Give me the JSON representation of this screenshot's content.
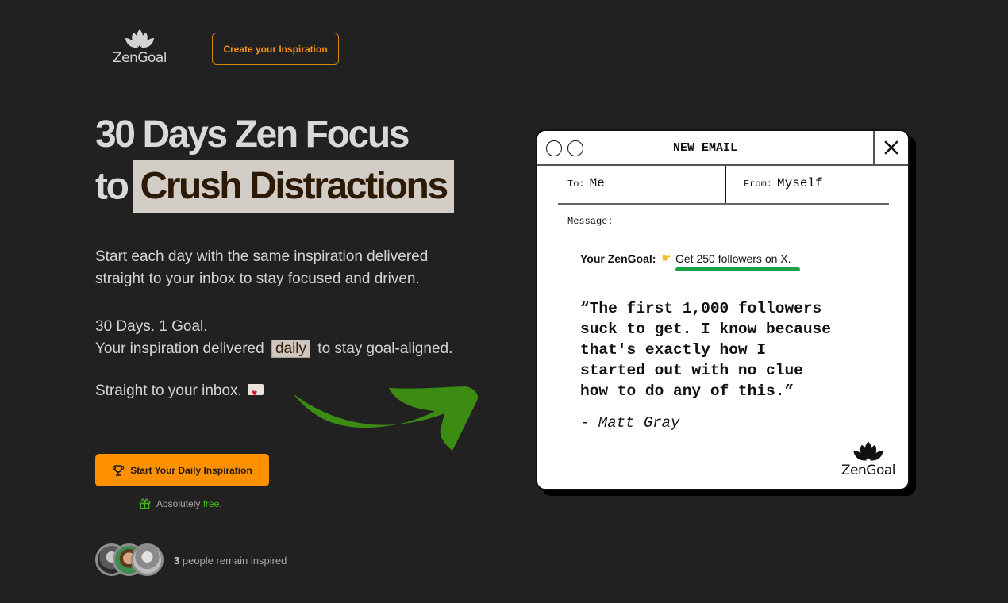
{
  "header": {
    "logo_text": "ZenGoal",
    "create_button": "Create your Inspiration"
  },
  "hero": {
    "title_line1": "30 Days Zen Focus",
    "title_line2_prefix": "to",
    "title_highlight": "Crush Distractions",
    "paragraph1": "Start each day with the same inspiration delivered straight to your inbox to stay focused and driven.",
    "paragraph2_line1": "30 Days. 1 Goal.",
    "paragraph2_before": "Your inspiration delivered",
    "paragraph2_highlight": "daily",
    "paragraph2_after": "to stay goal-aligned.",
    "paragraph3": "Straight to your inbox.",
    "cta_button": "Start Your Daily Inspiration",
    "free_prefix": "Absolutely",
    "free_word": "free",
    "free_suffix": ".",
    "people_count": "3",
    "people_text": "people remain inspired"
  },
  "email": {
    "title": "NEW EMAIL",
    "to_label": "To:",
    "to_value": "Me",
    "from_label": "From:",
    "from_value": "Myself",
    "message_label": "Message:",
    "goal_label": "Your ZenGoal:",
    "goal_value": "Get 250 followers on X.",
    "quote": "“The first 1,000 followers\nsuck to get. I know because\nthat's exactly how I\nstarted out with no clue\nhow to do any of this.”",
    "author": "- Matt Gray",
    "logo_text": "ZenGoal"
  },
  "colors": {
    "background": "#212121",
    "accent_orange": "#ff9000",
    "accent_green": "#44b515",
    "arrow_green": "#3c8c14",
    "underline_green": "#1aa346",
    "highlight_bg": "#d3cdc7"
  }
}
